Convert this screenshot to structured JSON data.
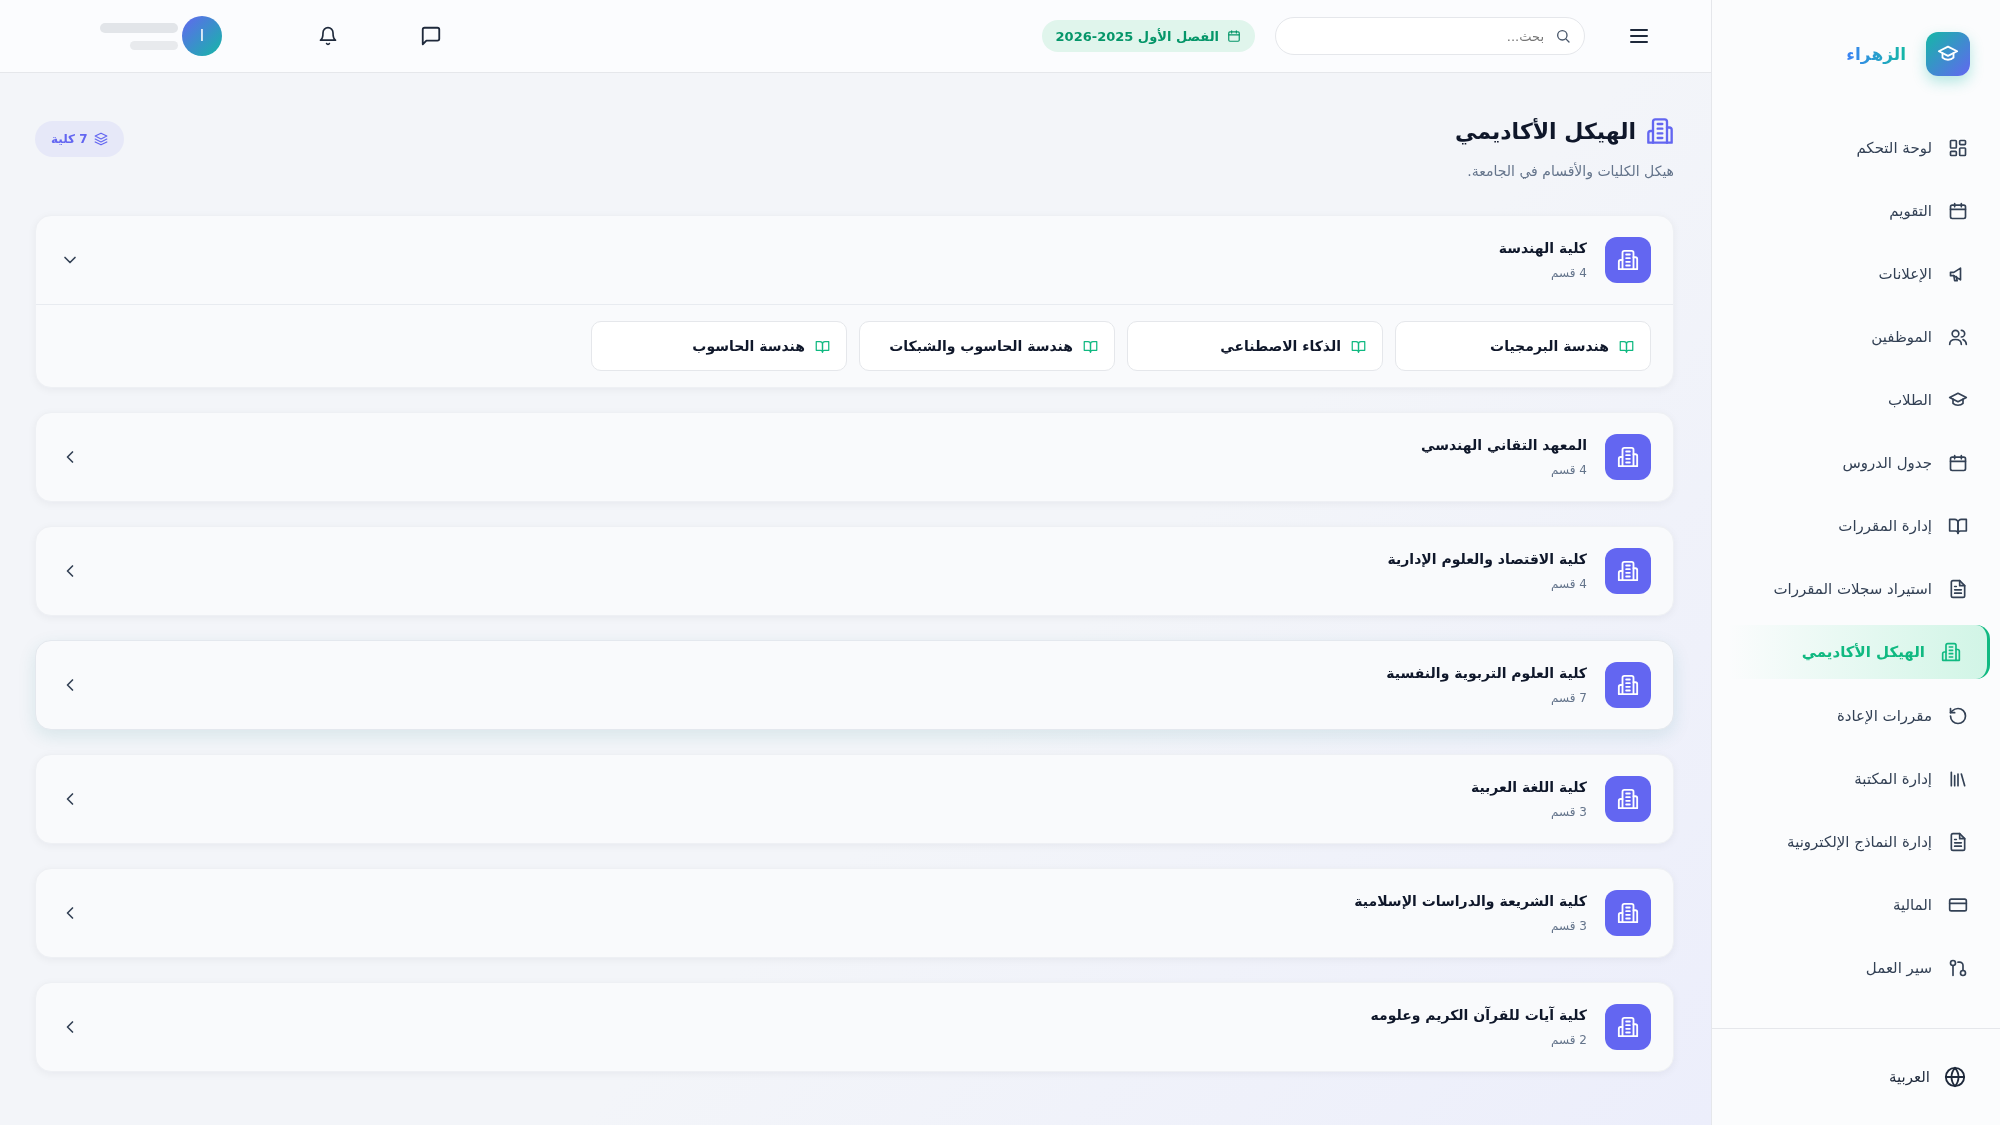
{
  "sidebar": {
    "brand": "الزهراء",
    "items": [
      {
        "label": "لوحة التحكم",
        "selected": false
      },
      {
        "label": "التقويم",
        "selected": false
      },
      {
        "label": "الإعلانات",
        "selected": false
      },
      {
        "label": "الموظفين",
        "selected": false
      },
      {
        "label": "الطلاب",
        "selected": false
      },
      {
        "label": "جدول الدروس",
        "selected": false
      },
      {
        "label": "إدارة المقررات",
        "selected": false
      },
      {
        "label": "استيراد سجلات المقررات",
        "selected": false
      },
      {
        "label": "الهيكل الأكاديمي",
        "selected": true
      },
      {
        "label": "مقررات الإعادة",
        "selected": false
      },
      {
        "label": "إدارة المكتبة",
        "selected": false
      },
      {
        "label": "إدارة النماذج الإلكترونية",
        "selected": false
      },
      {
        "label": "المالية",
        "selected": false
      },
      {
        "label": "سير العمل",
        "selected": false
      }
    ],
    "language": "العربية"
  },
  "topbar": {
    "search": {
      "placeholder": "بحث..."
    },
    "semester": "الفصل الأول 2025-2026",
    "avatar": "I"
  },
  "page": {
    "title": "الهيكل الأكاديمي",
    "subtitle": "هيكل الكليات والأقسام في الجامعة.",
    "count_badge": "7 كلية"
  },
  "faculties": [
    {
      "name": "كلية الهندسة",
      "count": "4 قسم",
      "expanded": true,
      "highlighted": false,
      "departments": [
        "هندسة البرمجيات",
        "الذكاء الاصطناعي",
        "هندسة الحاسوب والشبكات",
        "هندسة الحاسوب"
      ]
    },
    {
      "name": "المعهد التقاني الهندسي",
      "count": "4 قسم",
      "expanded": false,
      "highlighted": false
    },
    {
      "name": "كلية الاقتصاد والعلوم الإدارية",
      "count": "4 قسم",
      "expanded": false,
      "highlighted": false
    },
    {
      "name": "كلية العلوم التربوية والنفسية",
      "count": "7 قسم",
      "expanded": false,
      "highlighted": true
    },
    {
      "name": "كلية اللغة العربية",
      "count": "3 قسم",
      "expanded": false,
      "highlighted": false
    },
    {
      "name": "كلية الشريعة والدراسات الإسلامية",
      "count": "3 قسم",
      "expanded": false,
      "highlighted": false
    },
    {
      "name": "كلية آيات للقرآن الكريم وعلومه",
      "count": "2 قسم",
      "expanded": false,
      "highlighted": false
    }
  ]
}
